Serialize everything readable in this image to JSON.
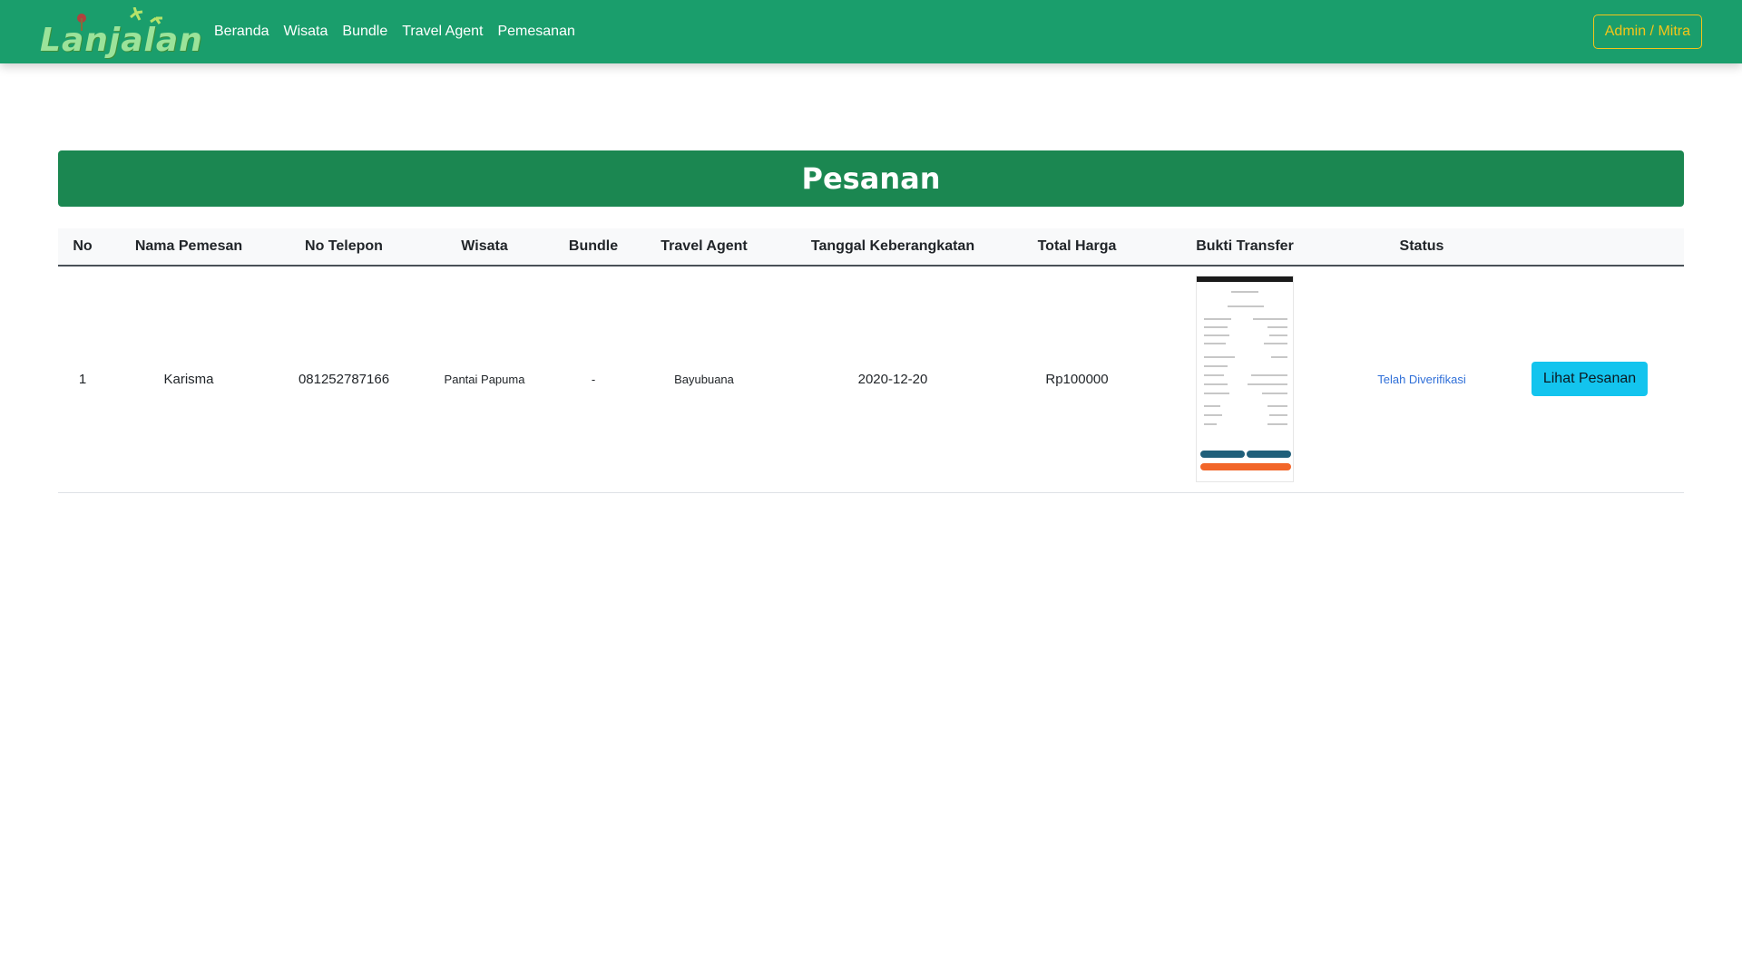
{
  "navbar": {
    "brand": "Lanjalan",
    "links": [
      "Beranda",
      "Wisata",
      "Bundle",
      "Travel Agent",
      "Pemesanan"
    ],
    "account_button": "Admin / Mitra"
  },
  "page": {
    "title": "Pesanan"
  },
  "table": {
    "headers": [
      "No",
      "Nama Pemesan",
      "No Telepon",
      "Wisata",
      "Bundle",
      "Travel Agent",
      "Tanggal Keberangkatan",
      "Total Harga",
      "Bukti Transfer",
      "Status",
      ""
    ],
    "rows": [
      {
        "no": "1",
        "nama": "Karisma",
        "telepon": "081252787166",
        "wisata": "Pantai Papuma",
        "bundle": "-",
        "travel_agent": "Bayubuana",
        "tanggal": "2020-12-20",
        "total": "Rp100000",
        "status": "Telah Diverifikasi",
        "action": "Lihat Pesanan"
      }
    ]
  },
  "colors": {
    "navbar": "#1a9e6c",
    "title_bar": "#1b8751",
    "accent_yellow": "#f5c518",
    "button_info": "#13c4ee",
    "status_link": "#2f6fd8"
  }
}
